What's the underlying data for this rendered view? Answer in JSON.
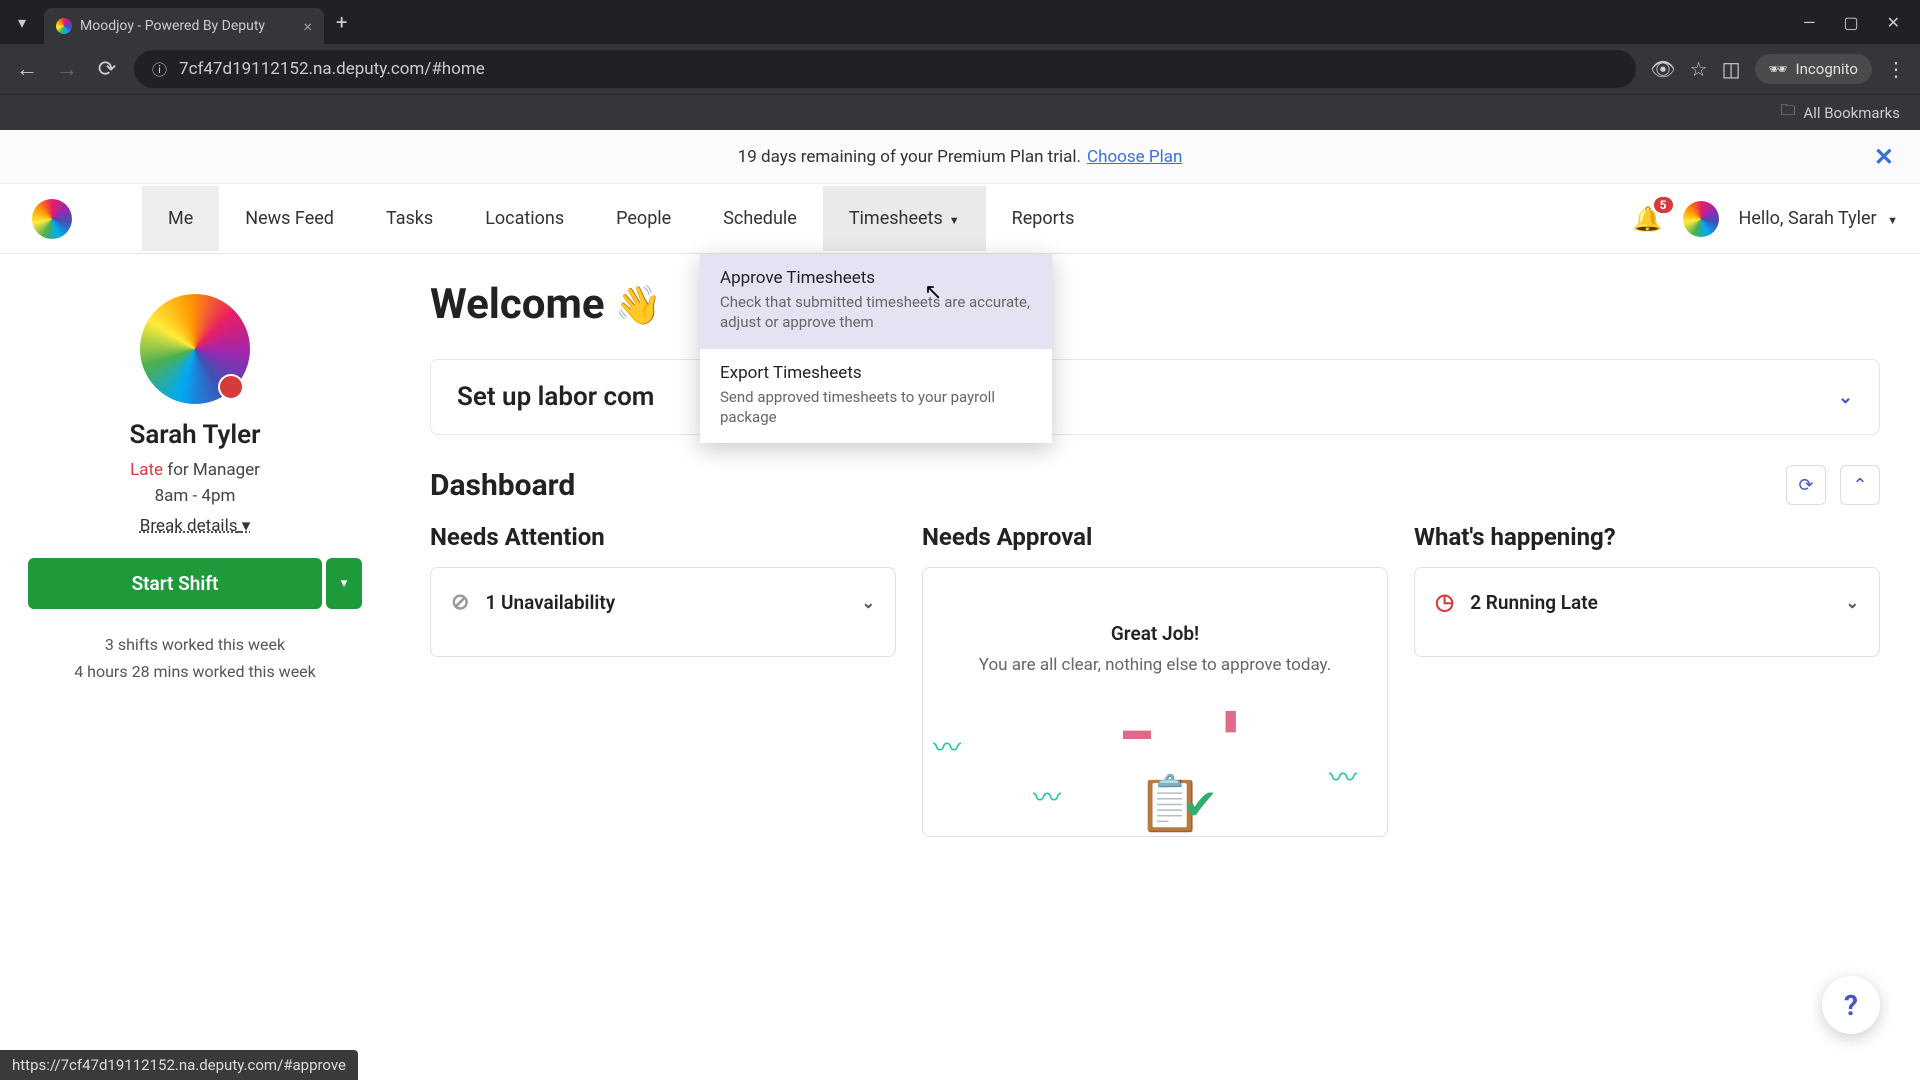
{
  "browser": {
    "tab_title": "Moodjoy - Powered By Deputy",
    "url": "7cf47d19112152.na.deputy.com/#home",
    "incognito_label": "Incognito",
    "bookmarks_label": "All Bookmarks",
    "status_url": "https://7cf47d19112152.na.deputy.com/#approve"
  },
  "banner": {
    "text": "19 days remaining of your Premium Plan trial.",
    "link": "Choose Plan"
  },
  "nav": {
    "items": [
      "Me",
      "News Feed",
      "Tasks",
      "Locations",
      "People",
      "Schedule",
      "Timesheets",
      "Reports"
    ],
    "notif_count": "5",
    "greeting": "Hello, Sarah Tyler"
  },
  "dropdown": {
    "items": [
      {
        "title": "Approve Timesheets",
        "desc": "Check that submitted timesheets are accurate, adjust or approve them"
      },
      {
        "title": "Export Timesheets",
        "desc": "Send approved timesheets to your payroll package"
      }
    ]
  },
  "profile": {
    "name": "Sarah Tyler",
    "status_prefix": "Late",
    "status_suffix": " for Manager",
    "hours": "8am - 4pm",
    "break_label": "Break details",
    "start_label": "Start Shift",
    "stat1": "3 shifts worked this week",
    "stat2": "4 hours 28 mins worked this week"
  },
  "main": {
    "welcome": "Welcome",
    "setup_title": "Set up labor com",
    "dashboard_title": "Dashboard",
    "cols": {
      "attention": {
        "title": "Needs Attention",
        "item": "1 Unavailability"
      },
      "approval": {
        "title": "Needs Approval",
        "heading": "Great Job!",
        "sub": "You are all clear, nothing else to approve today."
      },
      "happening": {
        "title": "What's happening?",
        "item": "2 Running Late"
      }
    }
  }
}
